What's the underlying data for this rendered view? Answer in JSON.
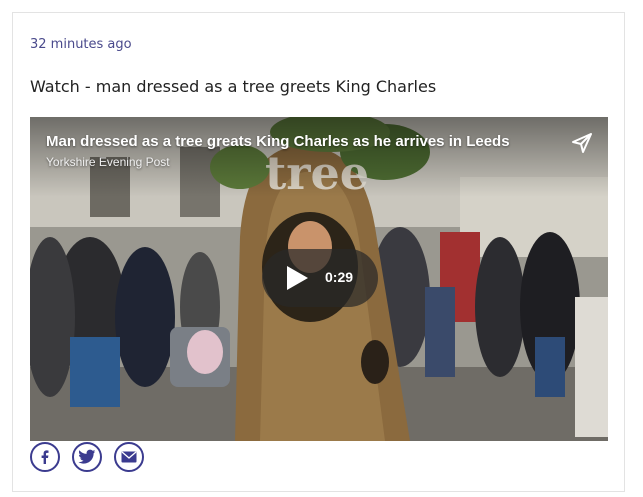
{
  "post": {
    "timestamp": "32 minutes ago",
    "headline": "Watch - man dressed as a tree greets King Charles"
  },
  "video": {
    "title": "Man dressed as a tree greats King Charles as he arrives in Leeds",
    "source": "Yorkshire Evening Post",
    "duration": "0:29",
    "sign_text": "tree",
    "play_icon": "play-icon",
    "share_icon": "send-icon"
  },
  "share": {
    "items": [
      {
        "name": "facebook",
        "icon": "facebook-icon"
      },
      {
        "name": "twitter",
        "icon": "twitter-icon"
      },
      {
        "name": "email",
        "icon": "email-icon"
      }
    ],
    "color": "#3b3b8f"
  }
}
